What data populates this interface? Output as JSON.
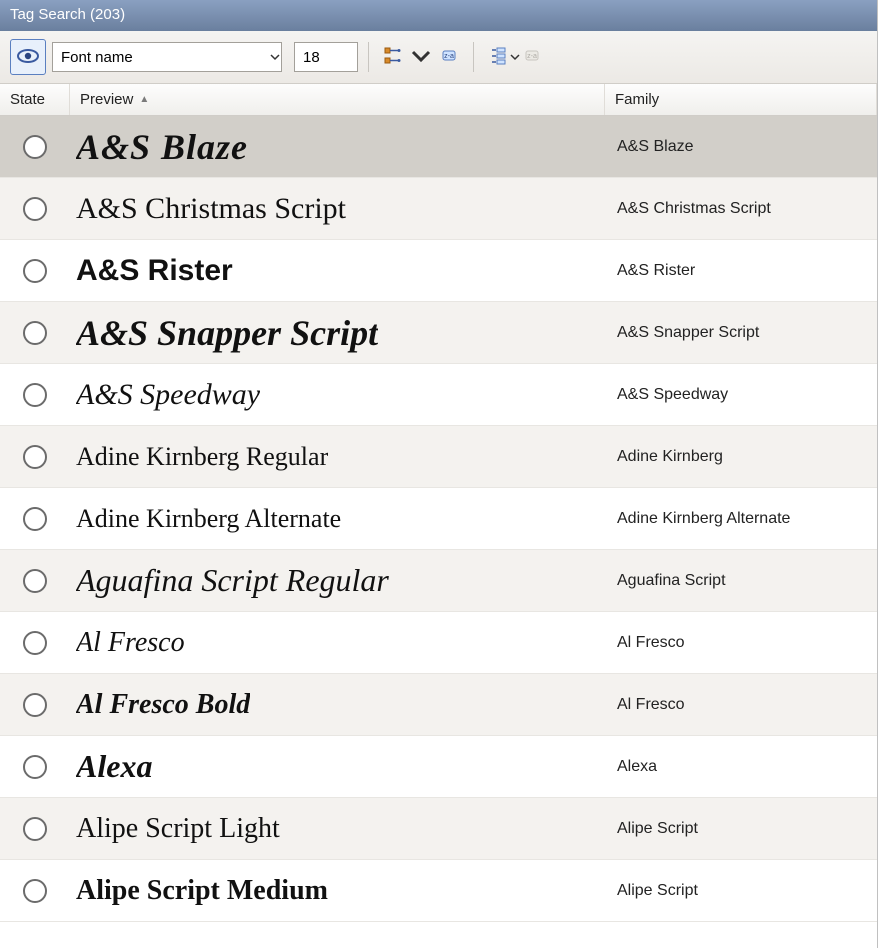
{
  "title": "Tag Search (203)",
  "toolbar": {
    "font_field_value": "Font name",
    "size_value": "18"
  },
  "columns": {
    "state": "State",
    "preview": "Preview",
    "family": "Family",
    "sort_indicator": "▲"
  },
  "rows": [
    {
      "preview": "A&S Blaze",
      "family": "A&S Blaze",
      "cls": "f-blaze",
      "selected": true
    },
    {
      "preview": "A&S Christmas Script",
      "family": "A&S Christmas Script",
      "cls": "f-xmas"
    },
    {
      "preview": "A&S Rister",
      "family": "A&S Rister",
      "cls": "f-rister"
    },
    {
      "preview": "A&S Snapper Script",
      "family": "A&S Snapper Script",
      "cls": "f-snapper"
    },
    {
      "preview": "A&S Speedway",
      "family": "A&S Speedway",
      "cls": "f-speedway"
    },
    {
      "preview": "Adine Kirnberg Regular",
      "family": "Adine Kirnberg",
      "cls": "f-adine"
    },
    {
      "preview": "Adine Kirnberg Alternate",
      "family": "Adine Kirnberg Alternate",
      "cls": "f-adinealt"
    },
    {
      "preview": "Aguafina Script Regular",
      "family": "Aguafina Script",
      "cls": "f-aguafina"
    },
    {
      "preview": "Al Fresco",
      "family": "Al Fresco",
      "cls": "f-alfresco"
    },
    {
      "preview": "Al Fresco Bold",
      "family": "Al Fresco",
      "cls": "f-alfrescob"
    },
    {
      "preview": "Alexa",
      "family": "Alexa",
      "cls": "f-alexa"
    },
    {
      "preview": "Alipe Script Light",
      "family": "Alipe Script",
      "cls": "f-alipel"
    },
    {
      "preview": "Alipe Script Medium",
      "family": "Alipe Script",
      "cls": "f-alipem"
    }
  ]
}
